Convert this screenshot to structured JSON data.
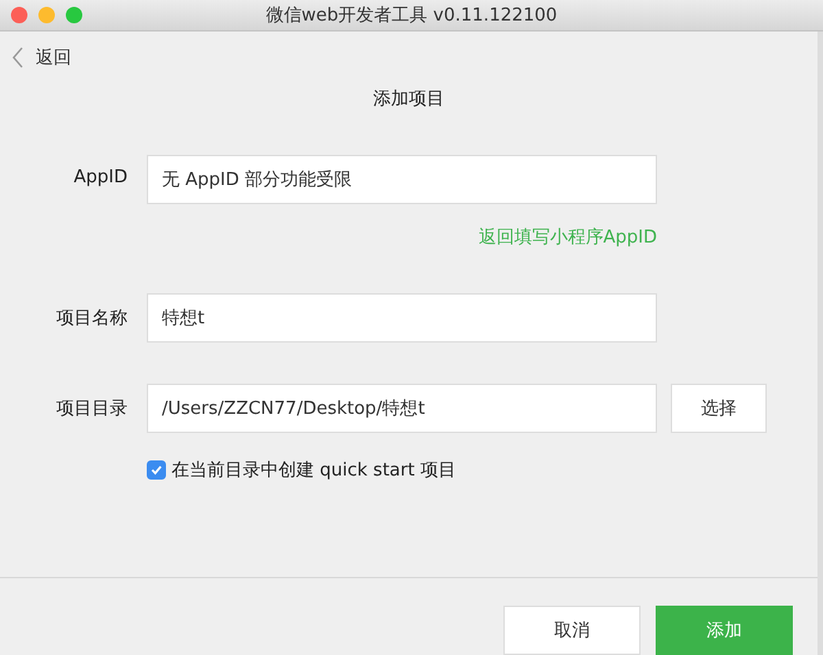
{
  "window": {
    "title": "微信web开发者工具 v0.11.122100"
  },
  "back": {
    "label": "返回"
  },
  "heading": "添加项目",
  "fields": [
    {
      "kind": "text",
      "label": "AppID",
      "value": "无 AppID 部分功能受限",
      "link": "返回填写小程序AppID"
    },
    {
      "kind": "text",
      "label": "项目名称",
      "value": "特想t"
    },
    {
      "kind": "dir",
      "label": "项目目录",
      "value": "/Users/ZZCN77/Desktop/特想t",
      "button": "选择"
    }
  ],
  "quick_start": {
    "label": "在当前目录中创建 quick start 项目",
    "checked": true
  },
  "buttons": [
    {
      "label": "取消",
      "primary": false
    },
    {
      "label": "添加",
      "primary": true
    }
  ]
}
